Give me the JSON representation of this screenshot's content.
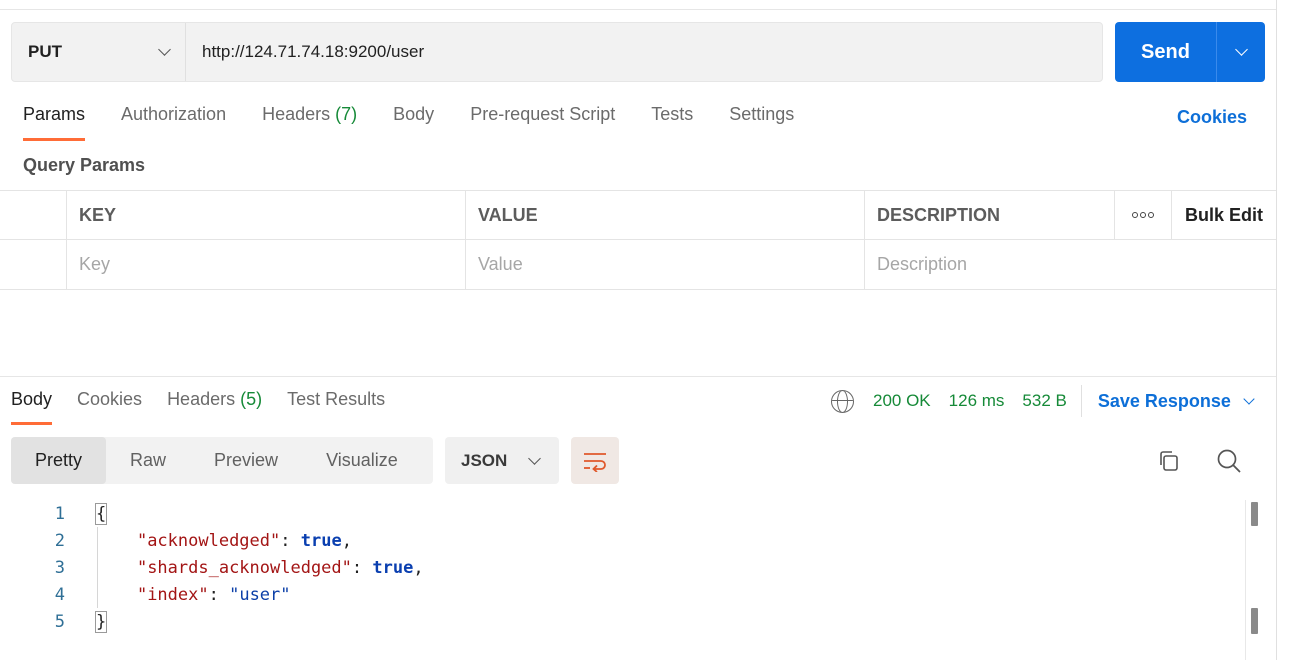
{
  "request": {
    "method": "PUT",
    "url": "http://124.71.74.18:9200/user",
    "send_label": "Send"
  },
  "request_tabs": {
    "params": "Params",
    "authorization": "Authorization",
    "headers": "Headers",
    "headers_count": "(7)",
    "body": "Body",
    "prerequest": "Pre-request Script",
    "tests": "Tests",
    "settings": "Settings",
    "cookies": "Cookies"
  },
  "query_params": {
    "title": "Query Params",
    "columns": {
      "key": "KEY",
      "value": "VALUE",
      "description": "DESCRIPTION",
      "bulk_edit": "Bulk Edit"
    },
    "placeholders": {
      "key": "Key",
      "value": "Value",
      "description": "Description"
    }
  },
  "response_tabs": {
    "body": "Body",
    "cookies": "Cookies",
    "headers": "Headers",
    "headers_count": "(5)",
    "test_results": "Test Results"
  },
  "response_meta": {
    "status": "200 OK",
    "time": "126 ms",
    "size": "532 B",
    "save_response": "Save Response"
  },
  "view": {
    "pretty": "Pretty",
    "raw": "Raw",
    "preview": "Preview",
    "visualize": "Visualize",
    "format": "JSON"
  },
  "code": {
    "line_numbers": [
      "1",
      "2",
      "3",
      "4",
      "5"
    ],
    "open_brace": "{",
    "close_brace": "}",
    "line2_key": "\"acknowledged\"",
    "line2_val": "true",
    "line3_key": "\"shards_acknowledged\"",
    "line3_val": "true",
    "line4_key": "\"index\"",
    "line4_val": "\"user\"",
    "colon": ": ",
    "comma": ","
  },
  "colors": {
    "send": "#0d6fe0",
    "accent": "#ff6c37",
    "status_green": "#168a38",
    "link_blue": "#0d6fd8"
  }
}
